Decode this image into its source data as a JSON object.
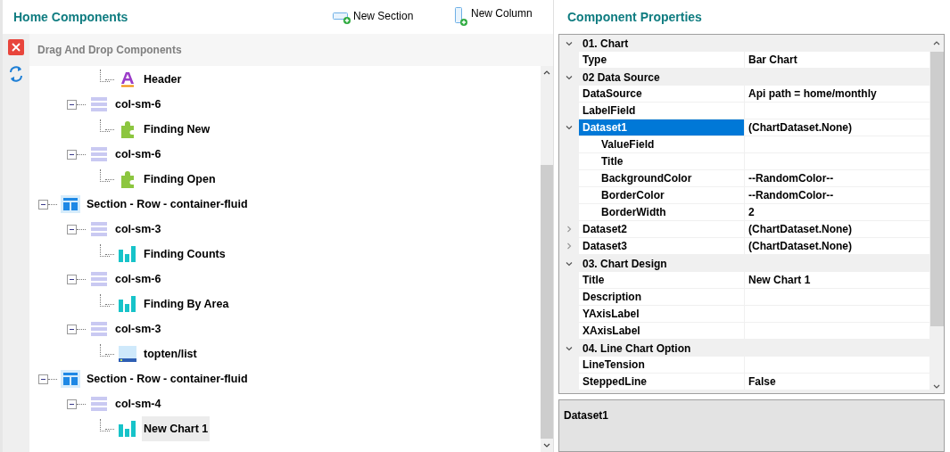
{
  "left_panel": {
    "title": "Home Components",
    "actions": [
      {
        "kind": "section",
        "label": "New Section"
      },
      {
        "kind": "column",
        "label": "New Column"
      }
    ],
    "tree_header": "Drag And Drop Components",
    "tree": [
      {
        "children": [
          {
            "children": [
              {
                "label": "Header",
                "kind": "text",
                "selected": false
              }
            ]
          },
          {
            "label": "col-sm-6",
            "kind": "column",
            "selected": false,
            "expanded": true,
            "children": [
              {
                "label": "Finding New",
                "kind": "plugin",
                "selected": false
              }
            ]
          },
          {
            "label": "col-sm-6",
            "kind": "column",
            "selected": false,
            "expanded": true,
            "children": [
              {
                "label": "Finding Open",
                "kind": "plugin",
                "selected": false
              }
            ]
          }
        ]
      },
      {
        "label": "Section - Row - container-fluid",
        "kind": "section",
        "selected": false,
        "expanded": true,
        "children": [
          {
            "label": "col-sm-3",
            "kind": "column",
            "selected": false,
            "expanded": true,
            "children": [
              {
                "label": "Finding Counts",
                "kind": "chart",
                "selected": false
              }
            ]
          },
          {
            "label": "col-sm-6",
            "kind": "column",
            "selected": false,
            "expanded": true,
            "children": [
              {
                "label": "Finding By Area",
                "kind": "chart",
                "selected": false
              }
            ]
          },
          {
            "label": "col-sm-3",
            "kind": "column",
            "selected": false,
            "expanded": true,
            "children": [
              {
                "label": "topten/list",
                "kind": "list",
                "selected": false
              }
            ]
          }
        ]
      },
      {
        "label": "Section - Row - container-fluid",
        "kind": "section",
        "selected": false,
        "expanded": true,
        "children": [
          {
            "label": "col-sm-4",
            "kind": "column",
            "selected": false,
            "expanded": true,
            "children": [
              {
                "label": "New Chart 1",
                "kind": "chart",
                "selected": true
              }
            ]
          }
        ]
      }
    ]
  },
  "right_panel": {
    "title": "Component Properties",
    "categories": [
      {
        "title": "01. Chart",
        "expanded": true,
        "properties": [
          {
            "name": "Type",
            "value": "Bar Chart",
            "selected": false
          }
        ]
      },
      {
        "title": "02 Data Source",
        "expanded": true,
        "properties": [
          {
            "name": "DataSource",
            "value": "Api path = home/monthly",
            "selected": false
          },
          {
            "name": "LabelField",
            "selected": false
          },
          {
            "name": "Dataset1",
            "value": "(ChartDataset.None)",
            "selected": true,
            "expanded": true,
            "children": [
              {
                "name": "ValueField",
                "selected": false
              },
              {
                "name": "Title",
                "selected": false
              },
              {
                "name": "BackgroundColor",
                "value": "--RandomColor--",
                "selected": false
              },
              {
                "name": "BorderColor",
                "value": "--RandomColor--",
                "selected": false
              },
              {
                "name": "BorderWidth",
                "value": "2",
                "selected": false
              }
            ]
          },
          {
            "name": "Dataset2",
            "value": "(ChartDataset.None)",
            "selected": false,
            "expanded": false
          },
          {
            "name": "Dataset3",
            "value": "(ChartDataset.None)",
            "selected": false,
            "expanded": false
          }
        ]
      },
      {
        "title": "03. Chart Design",
        "expanded": true,
        "properties": [
          {
            "name": "Title",
            "value": "New Chart 1",
            "selected": false
          },
          {
            "name": "Description",
            "selected": false
          },
          {
            "name": "YAxisLabel",
            "selected": false
          },
          {
            "name": "XAxisLabel",
            "selected": false
          }
        ]
      },
      {
        "title": "04. Line Chart Option",
        "expanded": true,
        "properties": [
          {
            "name": "LineTension",
            "selected": false
          },
          {
            "name": "SteppedLine",
            "value": "False",
            "selected": false
          }
        ]
      }
    ],
    "description": {
      "title": "Dataset1"
    }
  }
}
